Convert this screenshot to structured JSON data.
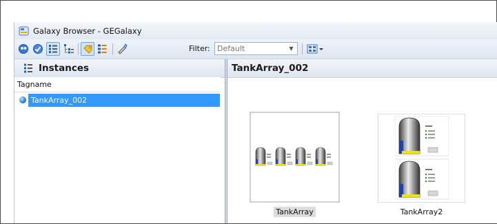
{
  "window": {
    "title": "Galaxy Browser - GEGalaxy"
  },
  "toolbar": {
    "buttons": [
      {
        "name": "galaxy-browse-icon"
      },
      {
        "name": "check-icon"
      },
      {
        "name": "tree-view-icon",
        "selected": true
      },
      {
        "name": "derivation-view-icon"
      },
      {
        "name": "tag-icon",
        "selected": true
      },
      {
        "name": "list-view-icon"
      },
      {
        "name": "filter-edit-icon"
      }
    ],
    "filter_label": "Filter:",
    "filter_value": "Default",
    "view_menu_icon": "grid-view-dropdown-icon"
  },
  "left_panel": {
    "title": "Instances",
    "column_header": "Tagname",
    "items": [
      {
        "label": "TankArray_002",
        "selected": true,
        "icon": "instance-sphere-icon"
      }
    ]
  },
  "right_panel": {
    "title": "TankArray_002",
    "thumbnails": [
      {
        "label": "TankArray",
        "selected": true
      },
      {
        "label": "TankArray2",
        "selected": false
      }
    ]
  },
  "colors": {
    "selection": "#3399ff",
    "tank_level": "#1a3fbf",
    "tank_base": "#f1e400"
  }
}
